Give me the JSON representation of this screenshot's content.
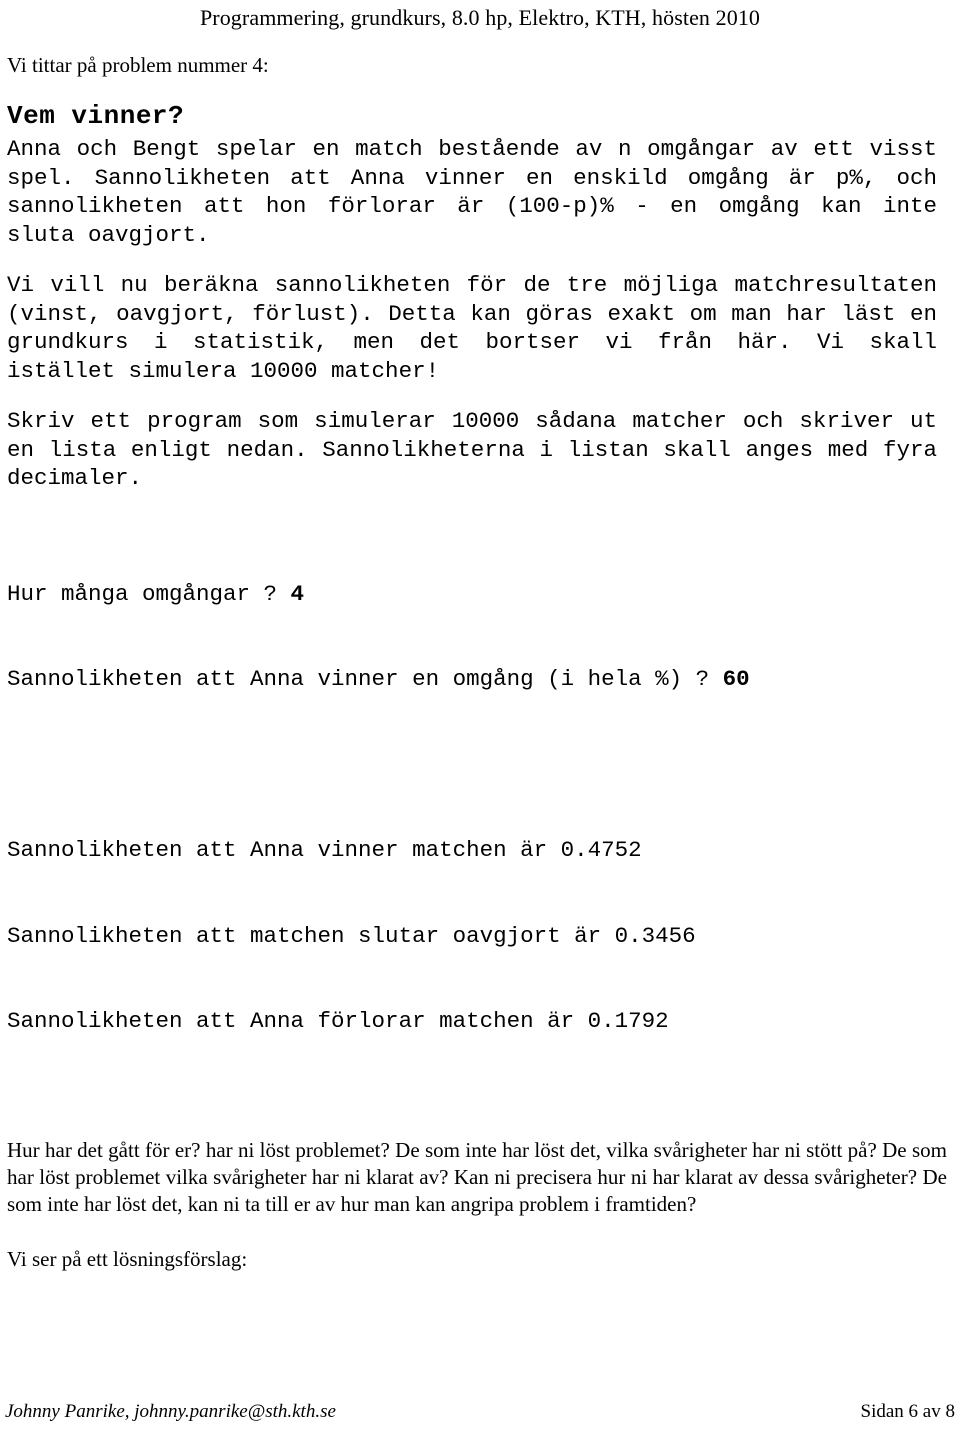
{
  "document": {
    "running_header": "Programmering, grundkurs, 8.0 hp, Elektro, KTH, hösten 2010",
    "intro_line": "Vi tittar på problem nummer 4:",
    "problem": {
      "heading": "Vem vinner?",
      "paragraph_1": "Anna och Bengt spelar en match bestående av n omgångar av ett visst spel. Sannolikheten att Anna vinner en enskild omgång är p%, och sannolikheten att hon förlorar är (100-p)% - en omgång kan inte sluta oavgjort.",
      "paragraph_2": "Vi vill nu beräkna sannolikheten för de tre möjliga matchresultaten (vinst, oavgjort, förlust). Detta kan göras exakt om man har läst en grundkurs i statistik, men det bortser vi från här. Vi skall istället simulera 10000 matcher!",
      "paragraph_3": "Skriv ett program som simulerar 10000 sådana matcher och skriver ut en lista enligt nedan. Sannolikheterna i listan skall anges med fyra decimaler."
    },
    "transcript": {
      "prompt_rounds_label": "Hur många omgångar ? ",
      "prompt_rounds_value": "4",
      "prompt_winprob_label": "Sannolikheten att Anna vinner en omgång (i hela %) ? ",
      "prompt_winprob_value": "60",
      "result_win": "Sannolikheten att Anna vinner matchen är 0.4752",
      "result_draw": "Sannolikheten att matchen slutar oavgjort är 0.3456",
      "result_loss": "Sannolikheten att Anna förlorar matchen är 0.1792"
    },
    "discussion_paragraph": "Hur har det gått för er? har ni löst problemet? De som inte har löst det, vilka svårigheter har ni stött på? De som har löst problemet vilka svårigheter har ni klarat av? Kan ni precisera hur ni har klarat av dessa svårigheter? De som inte har löst det, kan ni ta till er av hur man kan angripa problem i framtiden?",
    "closing_line": "Vi ser på ett lösningsförslag:",
    "footer": {
      "author": "Johnny Panrike, johnny.panrike@sth.kth.se",
      "page_label": "Sidan 6 av 8"
    }
  }
}
